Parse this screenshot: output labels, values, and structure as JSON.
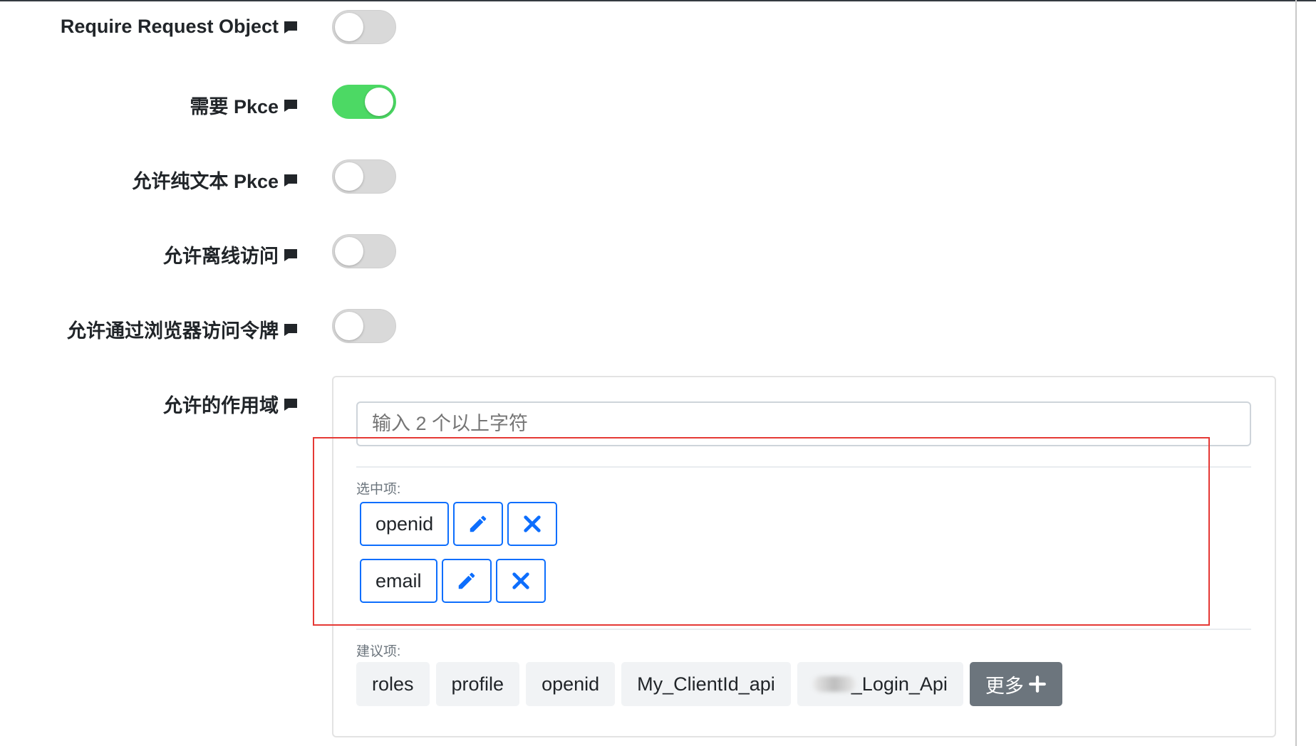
{
  "settings": [
    {
      "label": "Require Request Object",
      "enabled": false
    },
    {
      "label": "需要 Pkce",
      "enabled": true
    },
    {
      "label": "允许纯文本 Pkce",
      "enabled": false
    },
    {
      "label": "允许离线访问",
      "enabled": false
    },
    {
      "label": "允许通过浏览器访问令牌",
      "enabled": false
    }
  ],
  "scopes": {
    "label": "允许的作用域",
    "input_placeholder": "输入 2 个以上字符",
    "selected_title": "选中项:",
    "selected": [
      "openid",
      "email"
    ],
    "suggested_title": "建议项:",
    "suggested": [
      "roles",
      "profile",
      "openid",
      "My_ClientId_api",
      "_Login_Api"
    ],
    "more_label": "更多"
  },
  "colors": {
    "switch_on": "#4cd964",
    "switch_off": "#d9d9d9",
    "primary": "#0d6efd",
    "highlight": "#e53935",
    "more_button": "#6c757d"
  }
}
